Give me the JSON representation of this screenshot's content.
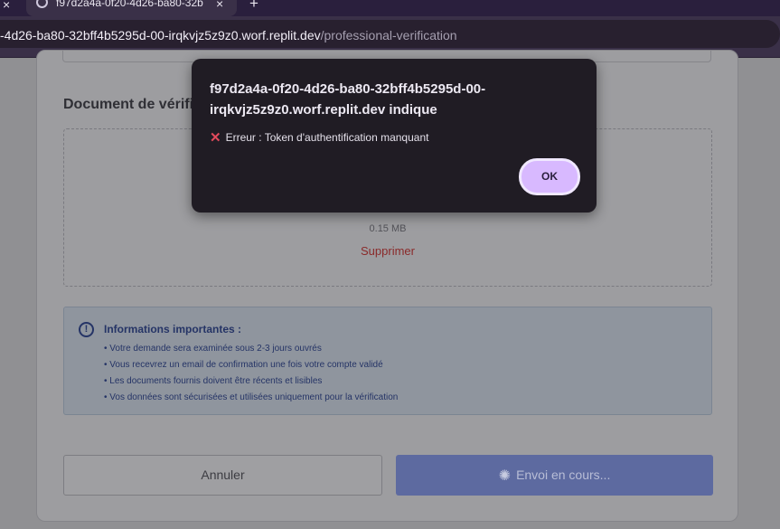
{
  "browser": {
    "tab": {
      "title": "f97d2a4a-0f20-4d26-ba80-32b",
      "icon": "globe-icon"
    },
    "url": {
      "host": "-4d26-ba80-32bff4b5295d-00-irqkvjz5z9z0.worf.replit.dev",
      "path": "/professional-verification"
    }
  },
  "page": {
    "section_title": "Document de vérifi",
    "file": {
      "size": "0.15 MB",
      "remove_label": "Supprimer"
    },
    "info": {
      "title": "Informations importantes :",
      "items": [
        "• Votre demande sera examinée sous 2-3 jours ouvrés",
        "• Vous recevrez un email de confirmation une fois votre compte validé",
        "• Les documents fournis doivent être récents et lisibles",
        "• Vos données sont sécurisées et utilisées uniquement pour la vérification"
      ]
    },
    "actions": {
      "cancel_label": "Annuler",
      "send_label": "Envoi en cours..."
    }
  },
  "dialog": {
    "title": "f97d2a4a-0f20-4d26-ba80-32bff4b5295d-00-irqkvjz5z9z0.worf.replit.dev indique",
    "message": "Erreur : Token d'authentification manquant",
    "ok_label": "OK"
  },
  "colors": {
    "dialog_bg": "#201c24",
    "ok_button": "#d8b9ff",
    "error_icon": "#e24a5c",
    "remove_link": "#8a2a2a",
    "send_button": "#5d6aa0"
  }
}
